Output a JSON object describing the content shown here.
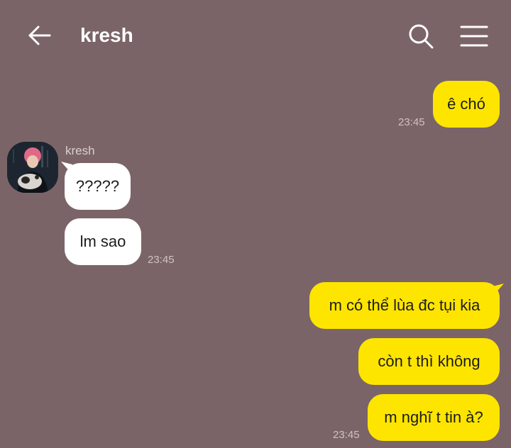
{
  "header": {
    "title": "kresh",
    "back_icon": "arrow-left-icon",
    "search_icon": "search-icon",
    "menu_icon": "hamburger-menu-icon"
  },
  "colors": {
    "background": "#7b6467",
    "outgoing_bubble": "#fee500",
    "incoming_bubble": "#ffffff",
    "timestamp": "#cfc2c3"
  },
  "messages": [
    {
      "direction": "outgoing",
      "text": "ê chó",
      "time": "23:45"
    },
    {
      "direction": "incoming",
      "sender": "kresh",
      "text": "?????"
    },
    {
      "direction": "incoming",
      "text": "lm sao",
      "time": "23:45"
    },
    {
      "direction": "outgoing",
      "text": "m có thể lùa đc tụi kia"
    },
    {
      "direction": "outgoing",
      "text": "còn t thì không"
    },
    {
      "direction": "outgoing",
      "text": "m nghĩ t tin à?",
      "time": "23:45"
    }
  ]
}
